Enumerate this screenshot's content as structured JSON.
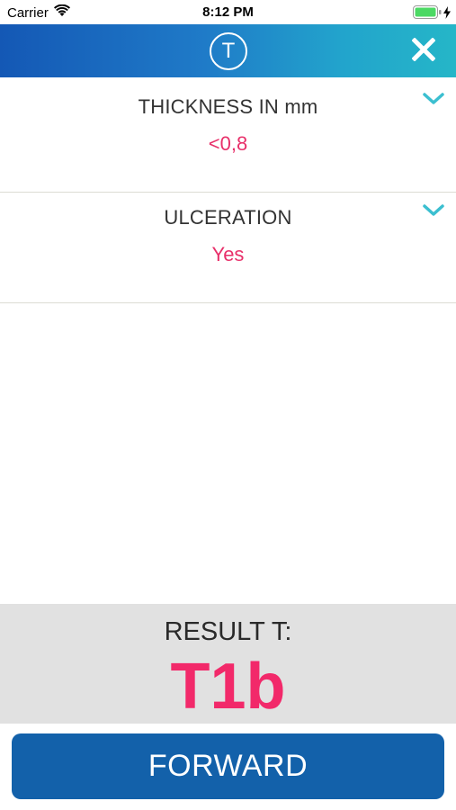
{
  "status_bar": {
    "carrier": "Carrier",
    "time": "8:12 PM",
    "icons": [
      "wifi-icon",
      "battery-icon",
      "charging-bolt-icon"
    ]
  },
  "header": {
    "logo_letter": "T",
    "close_icon": "close-icon",
    "gradient_colors": [
      "#1458b5",
      "#25b6c8"
    ]
  },
  "fields": [
    {
      "label": "THICKNESS IN mm",
      "value": "<0,8",
      "icon": "chevron-down-icon"
    },
    {
      "label": "ULCERATION",
      "value": "Yes",
      "icon": "chevron-down-icon"
    }
  ],
  "result": {
    "label": "RESULT T:",
    "value": "T1b"
  },
  "forward_button": {
    "label": "FORWARD"
  },
  "colors": {
    "accent_pink": "#e8306a",
    "chevron_teal": "#3bbfd0",
    "button_blue": "#1361aa",
    "result_background": "#e1e1e1"
  }
}
